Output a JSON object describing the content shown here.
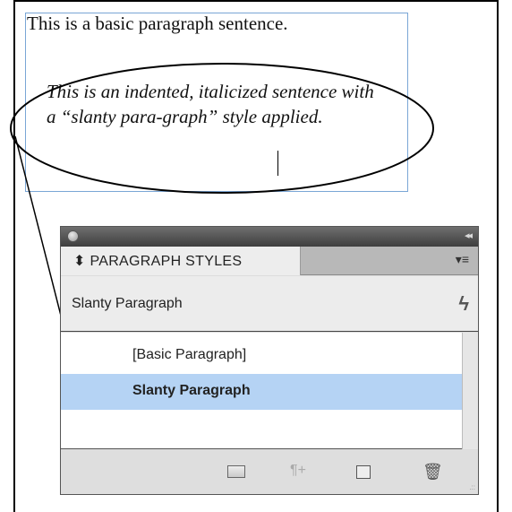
{
  "document": {
    "basic_sentence": "This is a basic paragraph sentence.",
    "slanty_sentence": "This is an indented, italicized sentence with a “slanty para-graph” style applied."
  },
  "panel": {
    "tab_label": "⬍ PARAGRAPH STYLES",
    "current_style": "Slanty Paragraph",
    "styles": [
      "[Basic Paragraph]",
      "Slanty Paragraph"
    ],
    "selected_index": 1,
    "collapse_glyph": "◂◂",
    "menu_glyph": "▾≡",
    "lightning_glyph": "ϟ",
    "new_style_glyph": "¶+",
    "delete_glyph": "🗑",
    "grip_glyph": ".::",
    "icons": [
      "close-icon",
      "collapse-icon",
      "panel-menu-icon",
      "lightning-icon",
      "new-group-folder-icon",
      "new-style-icon",
      "clear-overrides-icon",
      "trash-icon"
    ],
    "highlight_color": "#b5d3f4"
  }
}
